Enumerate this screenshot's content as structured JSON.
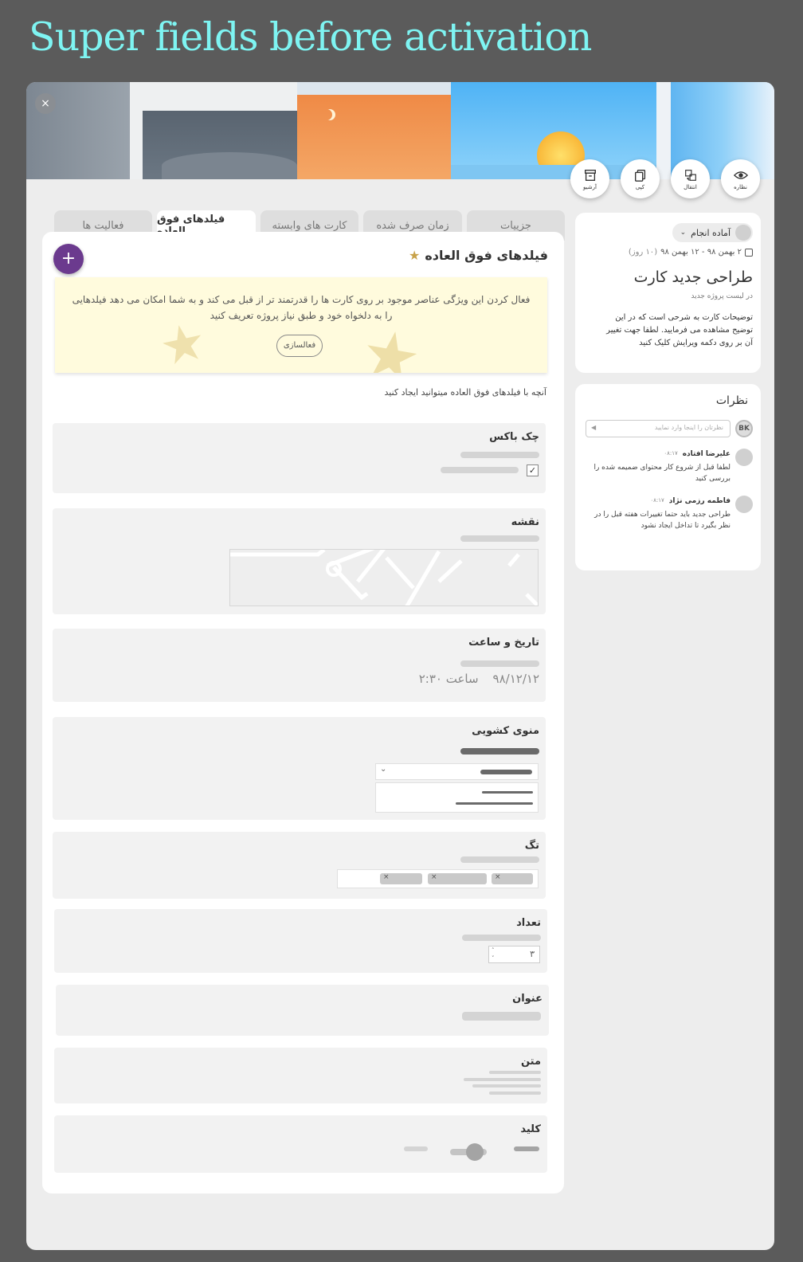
{
  "headline": "Super fields before activation",
  "cover": {
    "close_icon": "×"
  },
  "actions": [
    {
      "label": "نظاره",
      "icon": "eye-icon"
    },
    {
      "label": "انتقال",
      "icon": "move-icon"
    },
    {
      "label": "کپی",
      "icon": "copy-icon"
    },
    {
      "label": "آرشیو",
      "icon": "archive-icon"
    }
  ],
  "tabs": [
    {
      "label": "جزییات"
    },
    {
      "label": "زمان صرف شده"
    },
    {
      "label": "کارت های وابسته"
    },
    {
      "label": "فیلدهای فوق العاده",
      "active": true
    },
    {
      "label": "فعالیت ها"
    }
  ],
  "super": {
    "title": "فیلدهای فوق العاده",
    "banner_text": "فعال کردن این ویژگی عناصر موجود بر روی کارت ها را قدرتمند تر از قبل می کند و به شما امکان می دهد فیلدهایی را به دلخواه خود و طبق نیاز پروژه تعریف کنید",
    "activate_label": "فعالسازی",
    "subtitle": "آنچه با فیلدهای فوق العاده میتوانید ایجاد کنید",
    "add_label": "+"
  },
  "fields": {
    "checkbox": "چک باکس",
    "map": "نقشه",
    "datetime": "تاریخ و ساعت",
    "date_value": "۹۸/۱۲/۱۲",
    "time_value": "ساعت ۲:۳۰",
    "dropdown": "منوی کشویی",
    "tag": "تگ",
    "number": "تعداد",
    "number_value": "۳",
    "title": "عنوان",
    "text": "متن",
    "switch": "کلید"
  },
  "card": {
    "status": "آماده انجام",
    "date_range": "۲ بهمن ۹۸ - ۱۲ بهمن ۹۸",
    "duration": "(۱۰ روز)",
    "title": "طراحی جدید کارت",
    "list_info": "در لیست پروژه جدید",
    "description": "توضیحات کارت به شرحی است که در این توضیح مشاهده می فرمایید. لطفا جهت تغییر آن بر روی دکمه ویرایش کلیک کنید"
  },
  "comments": {
    "title": "نظرات",
    "avatar": "BK",
    "placeholder": "نظرتان را اینجا وارد نمایید",
    "items": [
      {
        "author": "علیرضا افتاده",
        "time": "۰۸:۱۷",
        "text": "لطفا قبل از شروع کار محتوای ضمیمه شده را بررسی کنید"
      },
      {
        "author": "فاطمه رزمی نژاد",
        "time": "۰۸:۱۷",
        "text": "طراحی جدید باید حتما تغییرات هفته قبل را در نظر بگیرد تا تداخل ایجاد نشود"
      }
    ]
  },
  "colors": {
    "headline": "#7ef4f2",
    "add_button": "#6b3a8e",
    "banner": "#fffbdd",
    "star": "#c8a24a"
  }
}
